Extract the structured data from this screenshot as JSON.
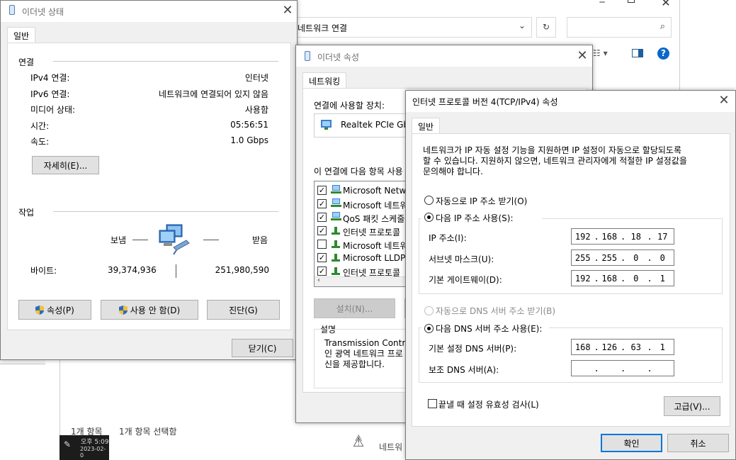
{
  "bg_window": {
    "address": "네트워크 연결",
    "status_count": "1개 항목",
    "status_selected": "1개 항목 선택함",
    "taskbar_time": "오후 5:09",
    "taskbar_date": "2023-02-0",
    "partial_item": "네트워"
  },
  "status_dialog": {
    "title": "이더넷 상태",
    "tab": "일반",
    "section_connection": "연결",
    "rows": [
      {
        "label": "IPv4 연결:",
        "value": "인터넷"
      },
      {
        "label": "IPv6 연결:",
        "value": "네트워크에 연결되어 있지 않음"
      },
      {
        "label": "미디어 상태:",
        "value": "사용함"
      },
      {
        "label": "시간:",
        "value": "05:56:51"
      },
      {
        "label": "속도:",
        "value": "1.0 Gbps"
      }
    ],
    "details_button": "자세히(E)...",
    "section_activity": "작업",
    "sent_label": "보냄",
    "recv_label": "받음",
    "bytes_label": "바이트:",
    "bytes_sent": "39,374,936",
    "bytes_recv": "251,980,590",
    "properties_button": "속성(P)",
    "disable_button": "사용 안 함(D)",
    "diagnose_button": "진단(G)",
    "close_button": "닫기(C)"
  },
  "props_dialog": {
    "title": "이더넷 속성",
    "tab": "네트워킹",
    "connect_using": "연결에 사용할 장치:",
    "adapter": "Realtek PCIe GbE",
    "items_label": "이 연결에 다음 항목 사용",
    "items": [
      {
        "label": "Microsoft Netwo",
        "checked": true,
        "icon": "network-client-icon"
      },
      {
        "label": "Microsoft 네트워",
        "checked": true,
        "icon": "network-client-icon"
      },
      {
        "label": "QoS 패킷 스케줄",
        "checked": true,
        "icon": "service-icon"
      },
      {
        "label": "인터넷 프로토콜",
        "checked": true,
        "icon": "protocol-icon"
      },
      {
        "label": "Microsoft 네트워",
        "checked": false,
        "icon": "protocol-icon"
      },
      {
        "label": "Microsoft LLDP",
        "checked": true,
        "icon": "protocol-icon"
      },
      {
        "label": "인터넷 프로토콜",
        "checked": true,
        "icon": "protocol-icon"
      }
    ],
    "install_button": "설치(N)...",
    "description_label": "설명",
    "description_text": "Transmission Control\n인 광역 네트워크 프로\n신을 제공합니다."
  },
  "ipv4_dialog": {
    "title": "인터넷 프로토콜 버전 4(TCP/IPv4) 속성",
    "tab": "일반",
    "description": "네트워크가 IP 자동 설정 기능을 지원하면 IP 설정이 자동으로 할당되도록\n할 수 있습니다. 지원하지 않으면, 네트워크 관리자에게 적절한 IP 설정값을\n문의해야 합니다.",
    "auto_ip": "자동으로 IP 주소 받기(O)",
    "manual_ip": "다음 IP 주소 사용(S):",
    "ip_label": "IP 주소(I):",
    "ip": [
      "192",
      "168",
      "18",
      "17"
    ],
    "mask_label": "서브넷 마스크(U):",
    "mask": [
      "255",
      "255",
      "0",
      "0"
    ],
    "gateway_label": "기본 게이트웨이(D):",
    "gateway": [
      "192",
      "168",
      "0",
      "1"
    ],
    "auto_dns": "자동으로 DNS 서버 주소 받기(B)",
    "manual_dns": "다음 DNS 서버 주소 사용(E):",
    "dns1_label": "기본 설정 DNS 서버(P):",
    "dns1": [
      "168",
      "126",
      "63",
      "1"
    ],
    "dns2_label": "보조 DNS 서버(A):",
    "dns2": [
      "",
      "",
      "",
      ""
    ],
    "validate": "끝낼 때 설정 유효성 검사(L)",
    "advanced_button": "고급(V)...",
    "ok_button": "확인",
    "cancel_button": "취소"
  }
}
